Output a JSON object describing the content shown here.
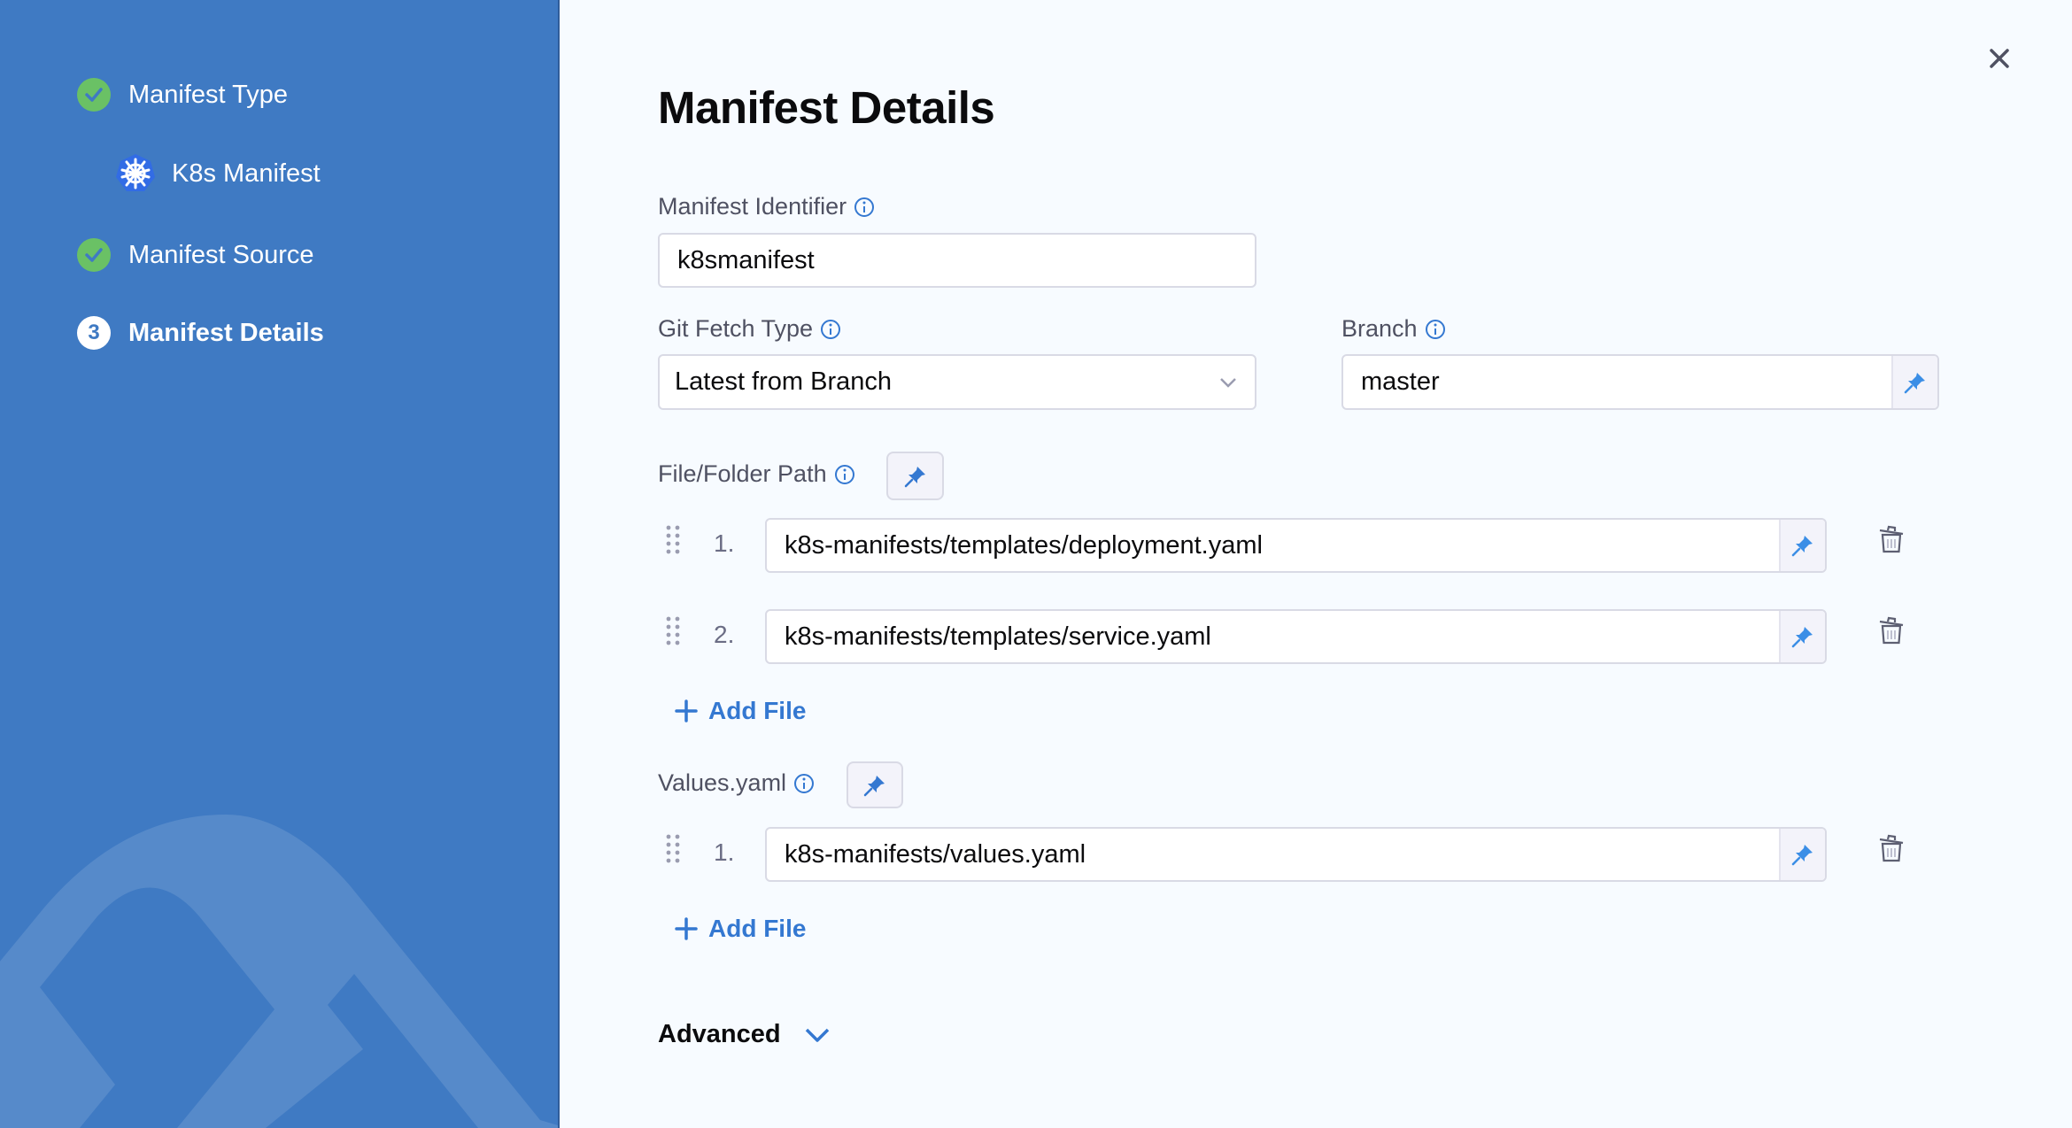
{
  "colors": {
    "sidebar_bg": "#3f7ac3",
    "step_done": "#6ac165",
    "accent": "#3478d1",
    "panel_bg": "#f7fbff",
    "label": "#4f5162"
  },
  "sidebar": {
    "steps": [
      {
        "label": "Manifest Type",
        "state": "done",
        "icon": "check-circle-icon"
      },
      {
        "label": "K8s Manifest",
        "state": "sub",
        "icon": "kubernetes-icon"
      },
      {
        "label": "Manifest Source",
        "state": "done",
        "icon": "check-circle-icon"
      },
      {
        "label": "Manifest Details",
        "state": "active",
        "number": "3"
      }
    ]
  },
  "header": {
    "title": "Manifest Details",
    "close_icon": "close-icon"
  },
  "form": {
    "manifest_identifier": {
      "label": "Manifest Identifier",
      "value": "k8smanifest"
    },
    "git_fetch_type": {
      "label": "Git Fetch Type",
      "value": "Latest from Branch"
    },
    "branch": {
      "label": "Branch",
      "value": "master"
    },
    "file_folder_path": {
      "label": "File/Folder Path",
      "items": [
        {
          "number": "1.",
          "value": "k8s-manifests/templates/deployment.yaml"
        },
        {
          "number": "2.",
          "value": "k8s-manifests/templates/service.yaml"
        }
      ],
      "add_label": "Add File"
    },
    "values_yaml": {
      "label": "Values.yaml",
      "items": [
        {
          "number": "1.",
          "value": "k8s-manifests/values.yaml"
        }
      ],
      "add_label": "Add File"
    },
    "advanced_label": "Advanced"
  }
}
